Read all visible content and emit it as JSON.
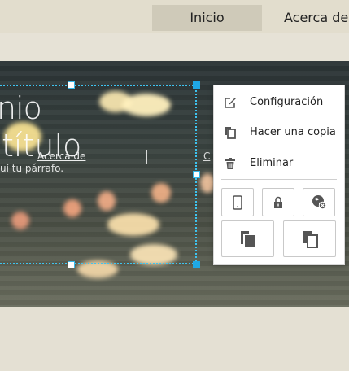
{
  "nav": {
    "items": [
      {
        "label": "Inicio",
        "active": true
      },
      {
        "label": "Acerca de",
        "active": false
      }
    ]
  },
  "hero": {
    "title_fragment": "nio",
    "subtitle_fragment": "título",
    "link_fragment": "Acerca de",
    "link_fragment_2": "C",
    "paragraph_fragment": "uí tu párrafo."
  },
  "context_menu": {
    "items": [
      {
        "label": "Configuración",
        "icon": "edit-icon"
      },
      {
        "label": "Hacer una copia",
        "icon": "copy-icon"
      },
      {
        "label": "Eliminar",
        "icon": "trash-icon"
      }
    ],
    "tool_buttons": [
      {
        "icon": "mobile-icon"
      },
      {
        "icon": "lock-icon"
      },
      {
        "icon": "hide-on-mobile-icon"
      },
      {
        "icon": "bring-forward-icon"
      },
      {
        "icon": "send-backward-icon"
      }
    ]
  },
  "colors": {
    "selection": "#3ec4f0",
    "handle_corner": "#1fa8e6",
    "active_nav": "#cfcab9"
  }
}
